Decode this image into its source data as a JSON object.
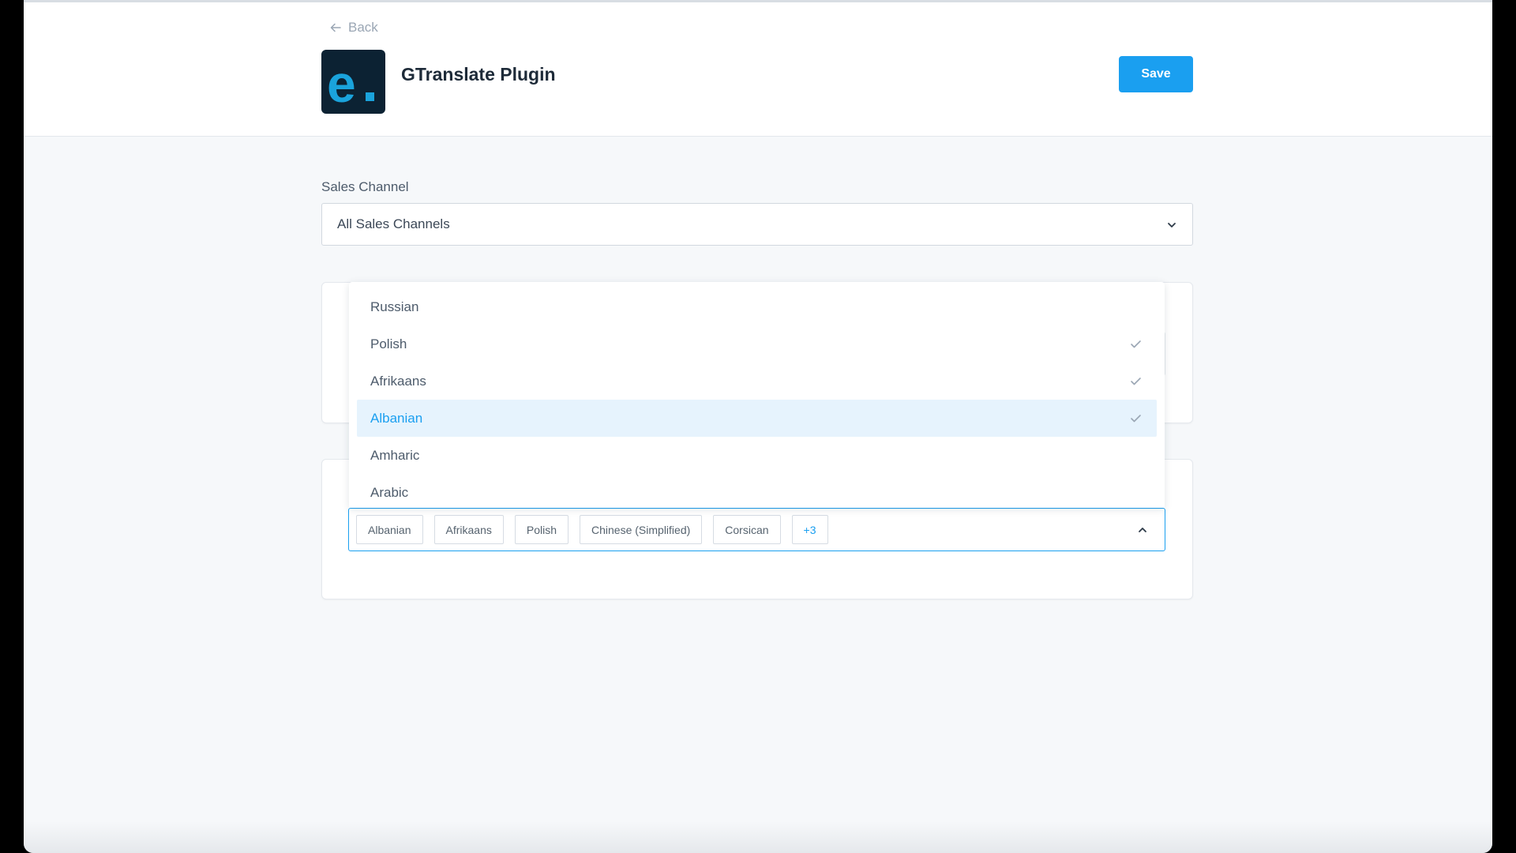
{
  "header": {
    "back_label": "Back",
    "title": "GTranslate Plugin",
    "save_label": "Save",
    "logo_letter": "e."
  },
  "sales_channel": {
    "label": "Sales Channel",
    "selected": "All Sales Channels"
  },
  "language_dropdown": {
    "options": [
      {
        "label": "Russian",
        "checked": false
      },
      {
        "label": "Polish",
        "checked": true
      },
      {
        "label": "Afrikaans",
        "checked": true
      },
      {
        "label": "Albanian",
        "checked": true,
        "highlighted": true
      },
      {
        "label": "Amharic",
        "checked": false
      },
      {
        "label": "Arabic",
        "checked": false
      }
    ]
  },
  "selected_languages": {
    "chips": [
      "Albanian",
      "Afrikaans",
      "Polish",
      "Chinese (Simplified)",
      "Corsican"
    ],
    "more_label": "+3"
  },
  "colors": {
    "accent": "#1a9ff0",
    "logo_bg": "#0c2233",
    "highlight_bg": "#e6f3fd"
  },
  "icons": [
    "arrow-left-icon",
    "chevron-down-icon",
    "chevron-up-icon",
    "check-icon"
  ]
}
